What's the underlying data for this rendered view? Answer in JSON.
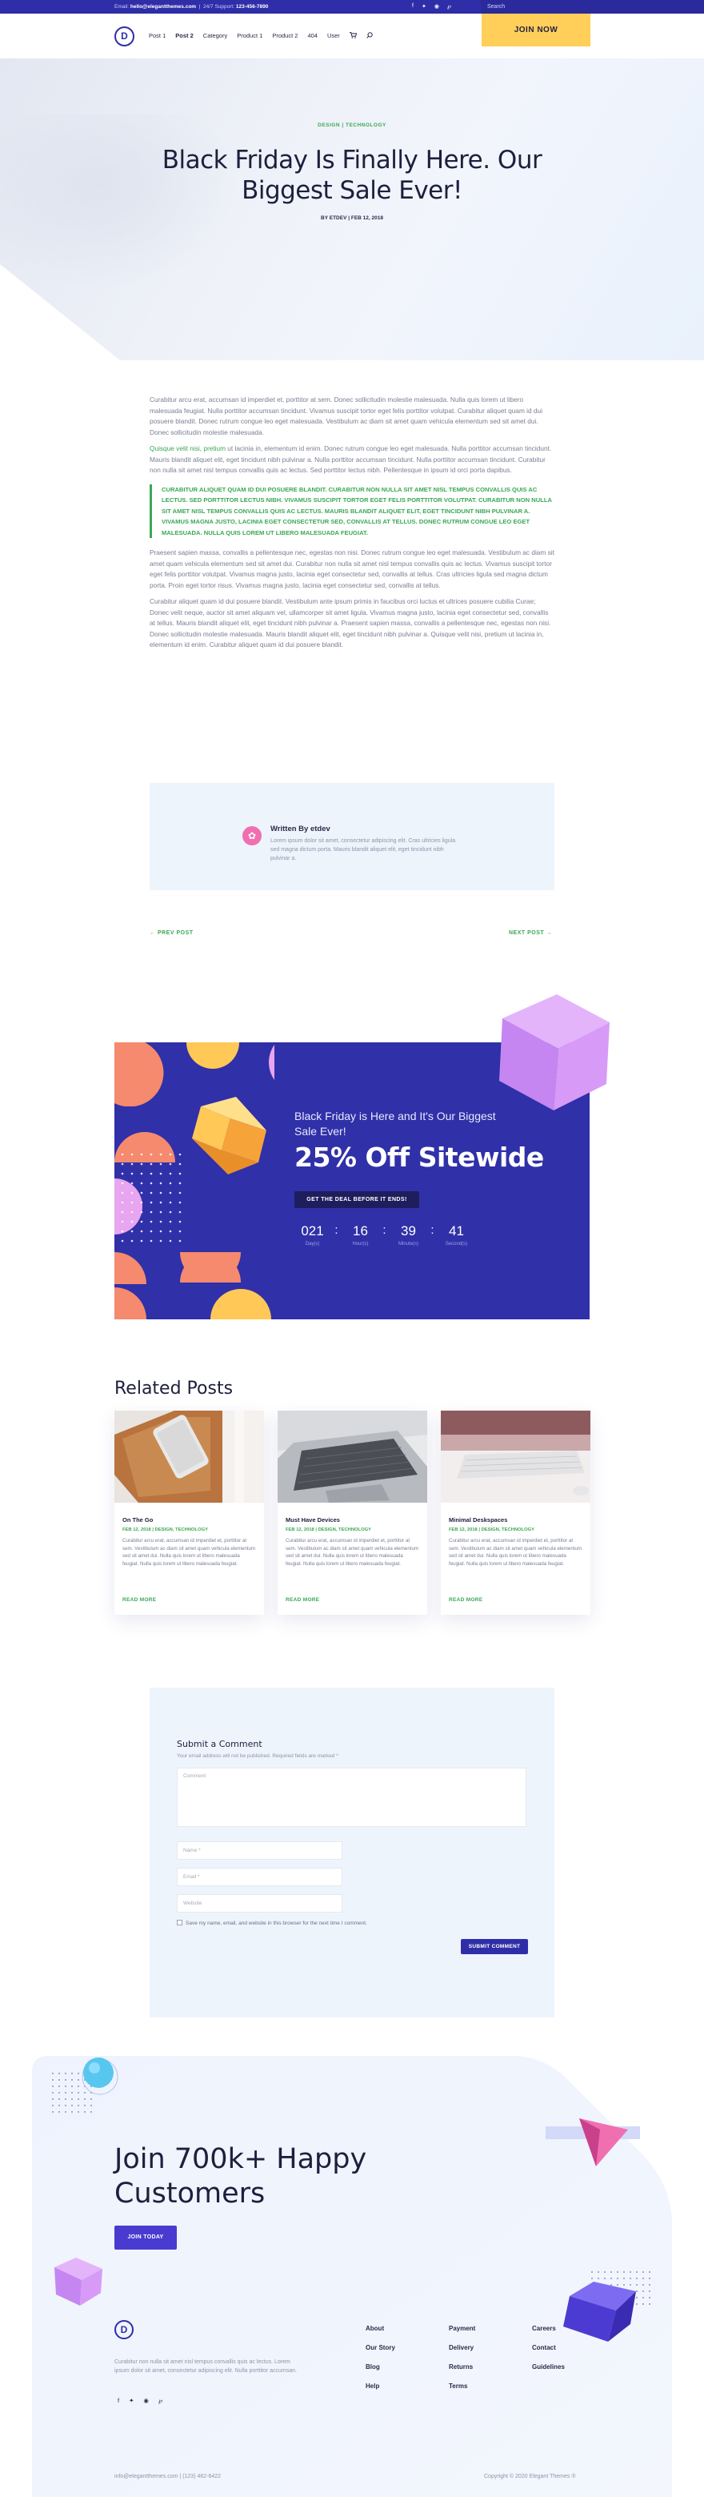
{
  "topbar": {
    "email_label": "Email:",
    "email": "hello@elegantthemes.com",
    "support_label": "24/7 Support:",
    "phone": "123-456-7890",
    "social_icons": [
      "facebook-icon",
      "twitter-icon",
      "instagram-icon",
      "pinterest-icon"
    ],
    "search_placeholder": "Search"
  },
  "header": {
    "logo_letter": "D",
    "nav": [
      "Post 1",
      "Post 2",
      "Category",
      "Product 1",
      "Product 2",
      "404",
      "User"
    ],
    "active_nav": "Post 2",
    "cta": "JOIN NOW"
  },
  "hero": {
    "category": "DESIGN | TECHNOLOGY",
    "title": "Black Friday Is Finally Here. Our Biggest Sale Ever!",
    "meta": "BY ETDEV | FEB 12, 2018"
  },
  "article": {
    "p1": "Curabitur arcu erat, accumsan id imperdiet et, porttitor at sem. Donec sollicitudin molestie malesuada. Nulla quis lorem ut libero malesuada feugiat. Nulla porttitor accumsan tincidunt. Vivamus suscipit tortor eget felis porttitor volutpat. Curabitur aliquet quam id dui posuere blandit. Donec rutrum congue leo eget malesuada. Vestibulum ac diam sit amet quam vehicula elementum sed sit amet dui. Donec sollicitudin molestie malesuada.",
    "p2_green": "Quisque velit nisi, pretium",
    "p2": " ut lacinia in, elementum id enim. Donec rutrum congue leo eget malesuada. Nulla porttitor accumsan tincidunt. Mauris blandit aliquet elit, eget tincidunt nibh pulvinar a. Nulla porttitor accumsan tincidunt. Nulla porttitor accumsan tincidunt. Curabitur non nulla sit amet nisl tempus convallis quis ac lectus. Sed porttitor lectus nibh. Pellentesque in ipsum id orci porta dapibus.",
    "quote": "Curabitur aliquet quam id dui posuere blandit. Curabitur non nulla sit amet nisl tempus convallis quis ac lectus. Sed porttitor lectus nibh. Vivamus suscipit tortor eget felis porttitor volutpat. Curabitur non nulla sit amet nisl tempus convallis quis ac lectus. Mauris blandit aliquet elit, eget tincidunt nibh pulvinar a. Vivamus magna justo, lacinia eget consectetur sed, convallis at tellus. Donec rutrum congue leo eget malesuada. Nulla quis lorem ut libero malesuada feugiat.",
    "p3": "Praesent sapien massa, convallis a pellentesque nec, egestas non nisi. Donec rutrum congue leo eget malesuada. Vestibulum ac diam sit amet quam vehicula elementum sed sit amet dui. Curabitur non nulla sit amet nisl tempus convallis quis ac lectus. Vivamus suscipit tortor eget felis porttitor volutpat. Vivamus magna justo, lacinia eget consectetur sed, convallis at tellus. Cras ultricies ligula sed magna dictum porta. Proin eget tortor risus. Vivamus magna justo, lacinia eget consectetur sed, convallis at tellus.",
    "p4": "Curabitur aliquet quam id dui posuere blandit. Vestibulum ante ipsum primis in faucibus orci luctus et ultrices posuere cubilia Curae; Donec velit neque, auctor sit amet aliquam vel, ullamcorper sit amet ligula. Vivamus magna justo, lacinia eget consectetur sed, convallis at tellus. Mauris blandit aliquet elit, eget tincidunt nibh pulvinar a. Praesent sapien massa, convallis a pellentesque nec, egestas non nisi. Donec sollicitudin molestie malesuada. Mauris blandit aliquet elit, eget tincidunt nibh pulvinar a. Quisque velit nisi, pretium ut lacinia in, elementum id enim. Curabitur aliquet quam id dui posuere blandit."
  },
  "author": {
    "name": "Written By etdev",
    "bio": "Lorem ipsum dolor sit amet, consectetur adipiscing elit. Cras ultricies ligula sed magna dictum porta. Mauris blandit aliquet elit, eget tincidunt nibh pulvinar a."
  },
  "post_nav": {
    "prev": "← PREV POST",
    "next": "NEXT POST →"
  },
  "promo": {
    "line1": "Black Friday is Here and It's Our Biggest Sale Ever!",
    "headline": "25% Off Sitewide",
    "button": "GET THE DEAL BEFORE IT ENDS!",
    "countdown": [
      {
        "value": "021",
        "label": "Day(s)"
      },
      {
        "value": "16",
        "label": "Hour(s)"
      },
      {
        "value": "39",
        "label": "Minute(s)"
      },
      {
        "value": "41",
        "label": "Second(s)"
      }
    ]
  },
  "related": {
    "title": "Related Posts",
    "posts": [
      {
        "title": "On The Go",
        "meta": "FEB 12, 2018 | DESIGN, TECHNOLOGY",
        "excerpt": "Curabitur arcu erat, accumsan id imperdiet et, porttitor at sem. Vestibulum ac diam sit amet quam vehicula elementum sed sit amet dui. Nulla quis lorem ut libero malesuada feugiat. Nulla quis lorem ut libero malesuada feugiat.",
        "more": "READ MORE"
      },
      {
        "title": "Must Have Devices",
        "meta": "FEB 12, 2018 | DESIGN, TECHNOLOGY",
        "excerpt": "Curabitur arcu erat, accumsan id imperdiet et, porttitor at sem. Vestibulum ac diam sit amet quam vehicula elementum sed sit amet dui. Nulla quis lorem ut libero malesuada feugiat. Nulla quis lorem ut libero malesuada feugiat.",
        "more": "READ MORE"
      },
      {
        "title": "Minimal Deskspaces",
        "meta": "FEB 12, 2018 | DESIGN, TECHNOLOGY",
        "excerpt": "Curabitur arcu erat, accumsan id imperdiet et, porttitor at sem. Vestibulum ac diam sit amet quam vehicula elementum sed sit amet dui. Nulla quis lorem ut libero malesuada feugiat. Nulla quis lorem ut libero malesuada feugiat.",
        "more": "READ MORE"
      }
    ]
  },
  "comment": {
    "title": "Submit a Comment",
    "note": "Your email address will not be published. Required fields are marked *",
    "comment_placeholder": "Comment",
    "name_placeholder": "Name *",
    "email_placeholder": "Email *",
    "website_placeholder": "Website",
    "consent": "Save my name, email, and website in this browser for the next time I comment.",
    "submit": "SUBMIT COMMENT"
  },
  "footer": {
    "headline": "Join 700k+ Happy Customers",
    "join_button": "JOIN TODAY",
    "logo_letter": "D",
    "description": "Curabitur non nulla sit amet nisl tempus convallis quis ac lectus. Lorem ipsum dolor sit amet, consectetur adipiscing elit. Nulla porttitor accumsan.",
    "social_icons": [
      "facebook-icon",
      "twitter-icon",
      "instagram-icon",
      "pinterest-icon"
    ],
    "col1": [
      "About",
      "Our Story",
      "Blog",
      "Help"
    ],
    "col2": [
      "Payment",
      "Delivery",
      "Returns",
      "Terms"
    ],
    "col3": [
      "Careers",
      "Contact",
      "Guidelines"
    ],
    "contact": "info@elegantthemes.com  |  (123) 462-6422",
    "copyright": "Copyright © 2020 Elegant Themes ®"
  },
  "colors": {
    "brand_blue": "#2f2ea8",
    "accent_yellow": "#ffcf5a",
    "accent_green": "#3aa853",
    "light_bg": "#eef4fc"
  }
}
